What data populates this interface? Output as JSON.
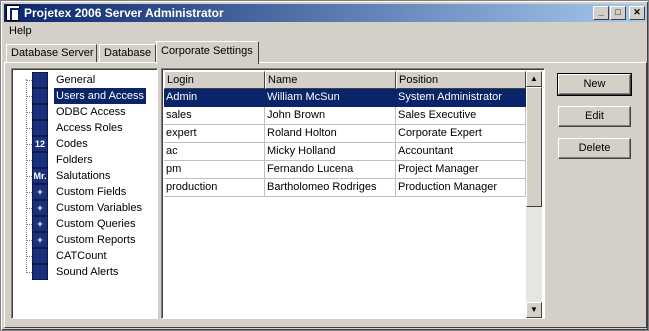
{
  "window": {
    "title": "Projetex 2006 Server Administrator"
  },
  "titlebar_buttons": {
    "minimize": "_",
    "maximize": "□",
    "close": "✕"
  },
  "menu": {
    "help": "Help"
  },
  "tabs": [
    {
      "label": "Database Server"
    },
    {
      "label": "Database"
    },
    {
      "label": "Corporate Settings"
    }
  ],
  "tree": {
    "items": [
      {
        "label": "General",
        "icon": "general-icon",
        "glyph": ""
      },
      {
        "label": "Users and Access",
        "icon": "users-icon",
        "glyph": ""
      },
      {
        "label": "ODBC Access",
        "icon": "database-icon",
        "glyph": ""
      },
      {
        "label": "Access Roles",
        "icon": "shield-icon",
        "glyph": ""
      },
      {
        "label": "Codes",
        "icon": "codes-icon",
        "glyph": "12"
      },
      {
        "label": "Folders",
        "icon": "folder-icon",
        "glyph": ""
      },
      {
        "label": "Salutations",
        "icon": "salutations-icon",
        "glyph": "Mr."
      },
      {
        "label": "Custom Fields",
        "icon": "plus-icon",
        "glyph": "+"
      },
      {
        "label": "Custom Variables",
        "icon": "plus-icon",
        "glyph": "+"
      },
      {
        "label": "Custom Queries",
        "icon": "plus-icon",
        "glyph": "+"
      },
      {
        "label": "Custom Reports",
        "icon": "plus-icon",
        "glyph": "+"
      },
      {
        "label": "CATCount",
        "icon": "catcount-icon",
        "glyph": ""
      },
      {
        "label": "Sound Alerts",
        "icon": "speaker-icon",
        "glyph": ""
      }
    ]
  },
  "grid": {
    "columns": [
      "Login",
      "Name",
      "Position"
    ],
    "rows": [
      [
        "Admin",
        "William McSun",
        "System Administrator"
      ],
      [
        "sales",
        "John Brown",
        "Sales Executive"
      ],
      [
        "expert",
        "Roland Holton",
        "Corporate Expert"
      ],
      [
        "ac",
        "Micky Holland",
        "Accountant"
      ],
      [
        "pm",
        "Fernando Lucena",
        "Project Manager"
      ],
      [
        "production",
        "Bartholomeo Rodriges",
        "Production Manager"
      ]
    ]
  },
  "scrollbar": {
    "up": "▲",
    "down": "▼"
  },
  "buttons": {
    "new": "New",
    "edit": "Edit",
    "delete": "Delete"
  }
}
